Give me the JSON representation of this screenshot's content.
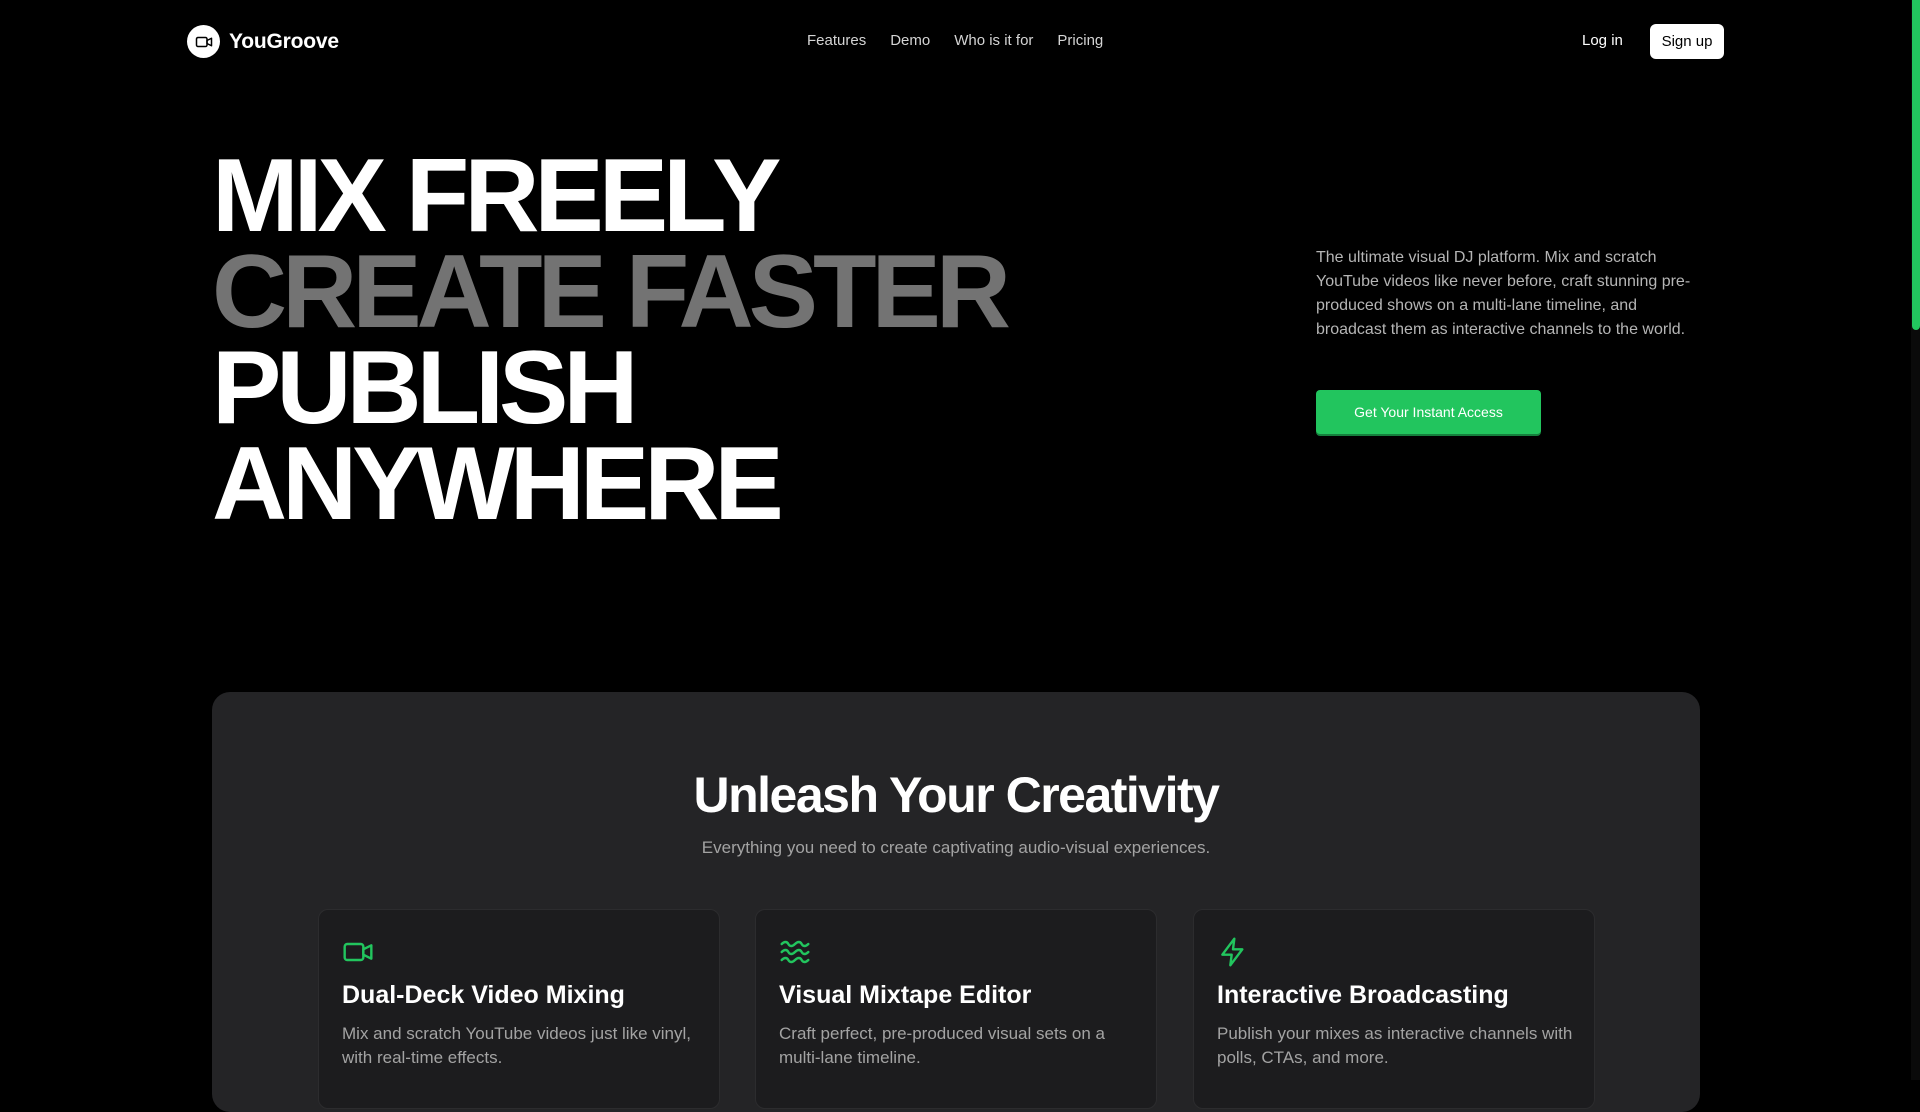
{
  "brand": {
    "name": "YouGroove",
    "logo_icon": "video-camera-icon"
  },
  "nav": {
    "links": [
      "Features",
      "Demo",
      "Who is it for",
      "Pricing"
    ],
    "login_label": "Log in",
    "signup_label": "Sign up"
  },
  "hero": {
    "lines": [
      "MIX FREELY",
      "CREATE FASTER",
      "PUBLISH",
      "ANYWHERE"
    ],
    "description": "The ultimate visual DJ platform. Mix and scratch YouTube videos like never before, craft stunning pre-produced shows on a multi-lane timeline, and broadcast them as interactive channels to the world.",
    "cta_label": "Get Your Instant Access"
  },
  "features": {
    "title": "Unleash Your Creativity",
    "subtitle": "Everything you need to create captivating audio-visual experiences.",
    "cards": [
      {
        "icon": "video-camera-icon",
        "title": "Dual-Deck Video Mixing",
        "description": "Mix and scratch YouTube videos just like vinyl, with real-time effects."
      },
      {
        "icon": "waves-icon",
        "title": "Visual Mixtape Editor",
        "description": "Craft perfect, pre-produced visual sets on a multi-lane timeline."
      },
      {
        "icon": "lightning-icon",
        "title": "Interactive Broadcasting",
        "description": "Publish your mixes as interactive channels with polls, CTAs, and more."
      }
    ]
  },
  "colors": {
    "background": "#000000",
    "accent": "#22c55e",
    "panel": "#242426",
    "card": "#1c1c1e",
    "muted_text": "#737373"
  }
}
